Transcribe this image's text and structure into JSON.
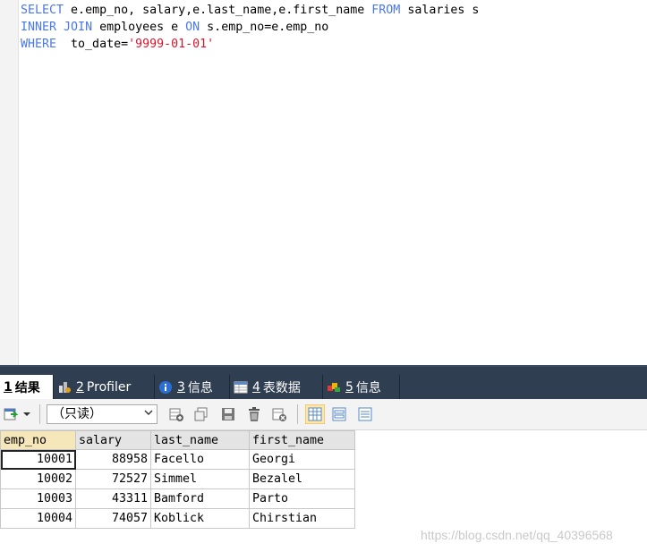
{
  "editor": {
    "lines": [
      [
        {
          "t": "SELECT",
          "c": "kw"
        },
        {
          "t": " e.emp_no, salary,e.last_name,e.first_name ",
          "c": ""
        },
        {
          "t": "FROM",
          "c": "kw"
        },
        {
          "t": " salaries s",
          "c": ""
        }
      ],
      [
        {
          "t": "INNER",
          "c": "kw"
        },
        {
          "t": " ",
          "c": ""
        },
        {
          "t": "JOIN",
          "c": "kw"
        },
        {
          "t": " employees e ",
          "c": ""
        },
        {
          "t": "ON",
          "c": "kw"
        },
        {
          "t": " s.emp_no=e.emp_no",
          "c": ""
        }
      ],
      [
        {
          "t": "WHERE",
          "c": "kw"
        },
        {
          "t": "  to_date=",
          "c": ""
        },
        {
          "t": "'9999-01-01'",
          "c": "str"
        }
      ]
    ]
  },
  "tabs": [
    {
      "num": "1",
      "label": "结果",
      "icon": "result-icon"
    },
    {
      "num": "2",
      "label": "Profiler",
      "icon": "profiler-icon"
    },
    {
      "num": "3",
      "label": "信息",
      "icon": "info-icon"
    },
    {
      "num": "4",
      "label": "表数据",
      "icon": "table-data-icon"
    },
    {
      "num": "5",
      "label": "信息",
      "icon": "info-icon"
    }
  ],
  "toolbar": {
    "mode_select": "（只读）"
  },
  "grid": {
    "columns": [
      "emp_no",
      "salary",
      "last_name",
      "first_name"
    ],
    "rows": [
      [
        "10001",
        "88958",
        "Facello",
        "Georgi"
      ],
      [
        "10002",
        "72527",
        "Simmel",
        "Bezalel"
      ],
      [
        "10003",
        "43311",
        "Bamford",
        "Parto"
      ],
      [
        "10004",
        "74057",
        "Koblick",
        "Chirstian"
      ]
    ]
  },
  "watermark": "https://blog.csdn.net/qq_40396568",
  "colors": {
    "keyword": "#4a78e6",
    "string": "#d8142b",
    "tabbar": "#2f3e51"
  }
}
